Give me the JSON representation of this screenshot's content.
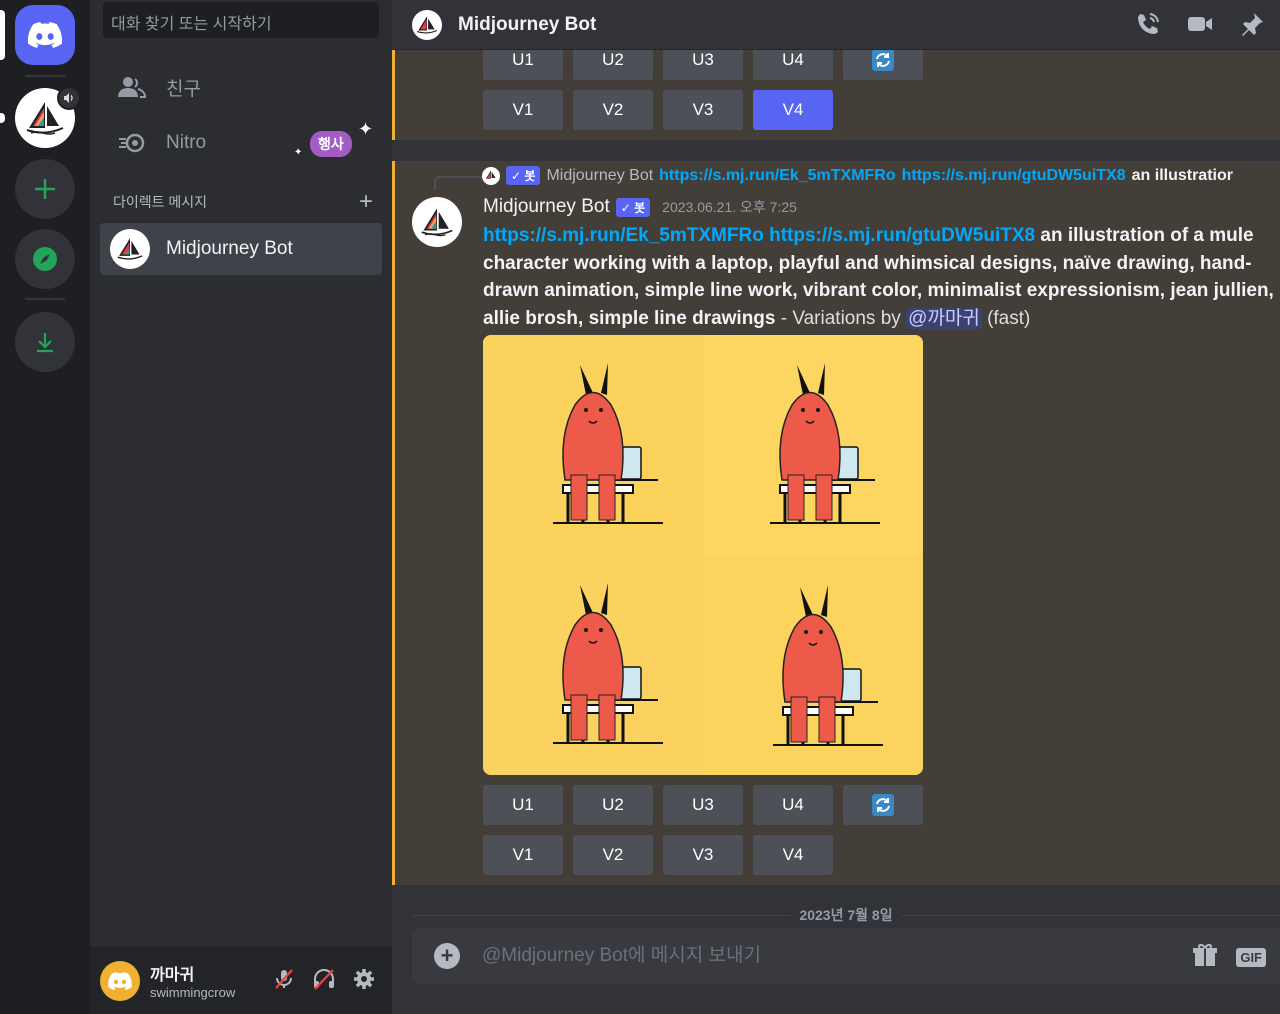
{
  "colors": {
    "blurple": "#5865f2",
    "link": "#00a8fc",
    "highlight_border": "#f0b132",
    "nitro": "#a25cc3"
  },
  "search": {
    "placeholder": "대화 찾기 또는 시작하기"
  },
  "sidebar": {
    "friends_label": "친구",
    "nitro_label": "Nitro",
    "nitro_badge": "행사",
    "dm_header": "다이렉트 메시지",
    "dm_items": [
      {
        "name": "Midjourney Bot"
      }
    ]
  },
  "user": {
    "name": "까마귀",
    "handle": "swimmingcrow"
  },
  "channel": {
    "title": "Midjourney Bot"
  },
  "prev_buttons": {
    "upscale": [
      "U1",
      "U2",
      "U3",
      "U4"
    ],
    "variation": [
      "V1",
      "V2",
      "V3",
      "V4"
    ],
    "selected": "V4"
  },
  "message": {
    "reply": {
      "author": "Midjourney Bot",
      "bot_tag": "✓ 봇",
      "link1": "https://s.mj.run/Ek_5mTXMFRo",
      "link2": "https://s.mj.run/gtuDW5uiTX8",
      "text": "an illustratior"
    },
    "author": "Midjourney Bot",
    "bot_tag": "✓ 봇",
    "timestamp": "2023.06.21. 오후 7:25",
    "link1": "https://s.mj.run/Ek_5mTXMFRo",
    "link2": "https://s.mj.run/gtuDW5uiTX8",
    "prompt": "an illustration of a mule character working with a laptop, playful and whimsical designs, naïve drawing, hand-drawn animation, simple line work, vibrant color, minimalist expressionism, jean jullien, allie brosh, simple line drawings",
    "suffix_before": " - Variations by ",
    "mention": "@까마귀",
    "suffix_after": " (fast)",
    "image_alt": "4-panel grid of red mule characters sitting at laptops on yellow background",
    "buttons": {
      "upscale": [
        "U1",
        "U2",
        "U3",
        "U4"
      ],
      "variation": [
        "V1",
        "V2",
        "V3",
        "V4"
      ]
    }
  },
  "date_divider": "2023년 7월 8일",
  "composer": {
    "placeholder": "@Midjourney Bot에 메시지 보내기",
    "gif_label": "GIF"
  }
}
